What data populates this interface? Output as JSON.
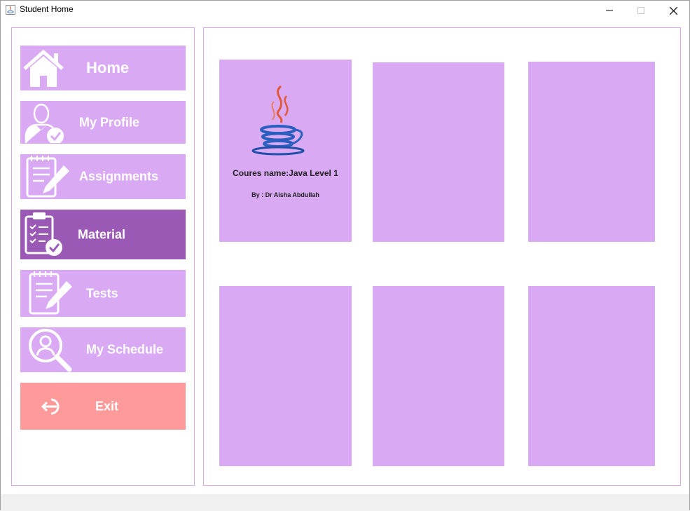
{
  "window": {
    "title": "Student Home"
  },
  "sidebar": {
    "items": [
      {
        "label": "Home",
        "icon": "house-icon"
      },
      {
        "label": "My Profile",
        "icon": "user-check-icon"
      },
      {
        "label": "Assignments",
        "icon": "notepad-pencil-icon"
      },
      {
        "label": "Material",
        "icon": "clipboard-check-icon",
        "active": true
      },
      {
        "label": "Tests",
        "icon": "notepad-pencil-icon"
      },
      {
        "label": "My Schedule",
        "icon": "user-search-icon"
      },
      {
        "label": "Exit",
        "icon": "exit-icon"
      }
    ]
  },
  "courses": [
    {
      "name": "Coures name:Java Level 1",
      "by": "By : Dr Aisha Abdullah",
      "icon": "java-logo-icon"
    }
  ],
  "colors": {
    "accent": "#d9a9f3",
    "active": "#9b59b6",
    "exit": "#ff9a9a",
    "border": "#d9a8e8"
  }
}
